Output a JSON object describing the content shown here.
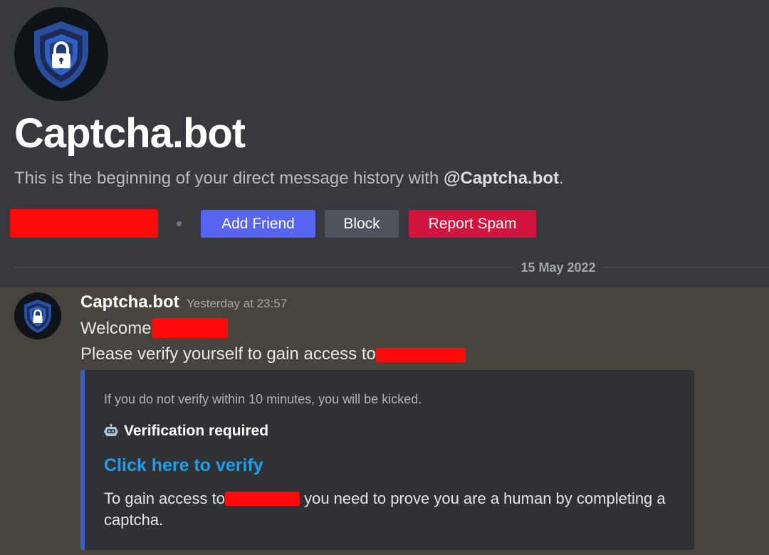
{
  "header": {
    "bot_name": "Captcha.bot",
    "intro_prefix": "This is the beginning of your direct message history with ",
    "intro_mention": "@Captcha.bot",
    "intro_suffix": ".",
    "buttons": {
      "add_friend": "Add Friend",
      "block": "Block",
      "report_spam": "Report Spam"
    },
    "date_divider": "15 May 2022"
  },
  "message": {
    "author": "Captcha.bot",
    "timestamp": "Yesterday at 23:57",
    "line1_prefix": "Welcome",
    "line2_prefix": "Please verify yourself to gain access to",
    "embed": {
      "notice": "If you do not verify within 10 minutes, you will be kicked.",
      "title": "Verification required",
      "title_icon": "robot-icon",
      "link_text": "Click here to verify",
      "desc_prefix": "To gain access to",
      "desc_suffix": " you need to prove you are a human by completing a captcha."
    }
  },
  "colors": {
    "header_bg": "#37393e",
    "message_bg": "#48443d",
    "embed_bg": "#303135",
    "embed_border": "#3b5fc3",
    "add_friend": "#5865f2",
    "block": "#4f545c",
    "report_spam": "#d3143e",
    "link": "#1e9fee",
    "redaction": "#ff0a0a"
  },
  "icons": {
    "avatar": "shield-lock-icon"
  }
}
